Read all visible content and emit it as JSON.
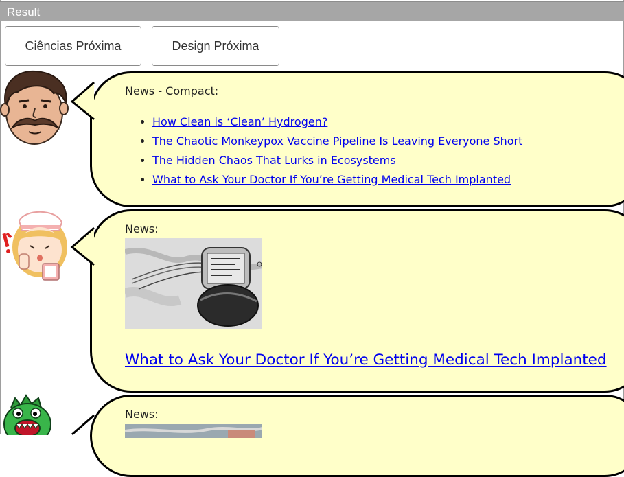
{
  "panel": {
    "title": "Result"
  },
  "buttons": {
    "sciences_next": "Ciências Próxima",
    "design_next": "Design Próxima"
  },
  "messages": [
    {
      "title": "News - Compact:",
      "links": [
        "How Clean is ‘Clean’ Hydrogen?",
        "The Chaotic Monkeypox Vaccine Pipeline Is Leaving Everyone Short",
        "The Hidden Chaos That Lurks in Ecosystems",
        "What to Ask Your Doctor If You’re Getting Medical Tech Implanted"
      ]
    },
    {
      "title": "News:",
      "image_icon": "pacemaker-photo",
      "headline": "What to Ask Your Doctor If You’re Getting Medical Tech Implanted"
    },
    {
      "title": "News:",
      "image_icon": "news-photo"
    }
  ],
  "colors": {
    "bubble": "#ffffc9",
    "link": "#0000ee",
    "header": "#a6a6a6"
  }
}
